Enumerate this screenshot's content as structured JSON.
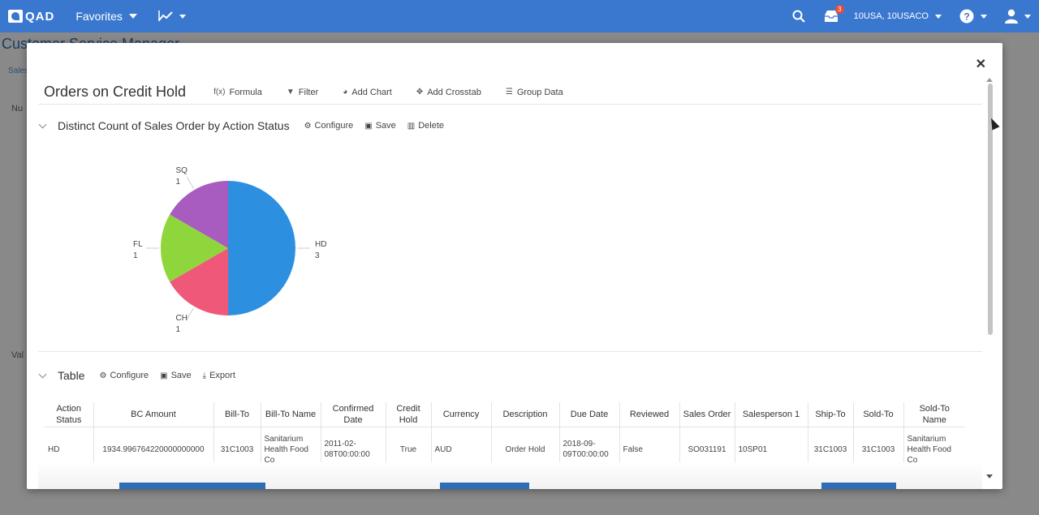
{
  "topbar": {
    "brand": "QAD",
    "favorites_label": "Favorites",
    "notification_count": "3",
    "domain_label": "10USA, 10USACO",
    "colors": {
      "bar": "#3a78cf"
    }
  },
  "background": {
    "page_title": "Customer Service Manager",
    "tab_label": "Sales",
    "stub_nu": "Nu",
    "stub_val": "Val"
  },
  "modal": {
    "title": "Orders on Credit Hold",
    "toolbar": {
      "formula": "Formula",
      "formula_prefix": "f(x)",
      "filter": "Filter",
      "add_chart": "Add Chart",
      "add_crosstab": "Add Crosstab",
      "group_data": "Group Data"
    },
    "chart_section": {
      "title": "Distinct Count of Sales Order by Action Status",
      "configure": "Configure",
      "save": "Save",
      "delete": "Delete"
    },
    "table_section": {
      "title": "Table",
      "configure": "Configure",
      "save": "Save",
      "export": "Export"
    }
  },
  "chart_data": {
    "type": "pie",
    "categories": [
      "HD",
      "CH",
      "FL",
      "SQ"
    ],
    "values": [
      3,
      1,
      1,
      1
    ],
    "colors": [
      "#2d8fe0",
      "#f0587a",
      "#8fd63c",
      "#a95cbf"
    ]
  },
  "table": {
    "columns": [
      "Action Status",
      "BC Amount",
      "Bill-To",
      "Bill-To Name",
      "Confirmed Date",
      "Credit Hold",
      "Currency",
      "Description",
      "Due Date",
      "Reviewed",
      "Sales Order",
      "Salesperson 1",
      "Ship-To",
      "Sold-To",
      "Sold-To Name"
    ],
    "rows": [
      [
        "HD",
        "1934.996764220000000000",
        "31C1003",
        "Sanitarium Health Food Co",
        "2011-02-08T00:00:00",
        "True",
        "AUD",
        "Order Hold",
        "2018-09-09T00:00:00",
        "False",
        "SO031191",
        "10SP01",
        "31C1003",
        "31C1003",
        "Sanitarium Health Food Co"
      ]
    ]
  }
}
